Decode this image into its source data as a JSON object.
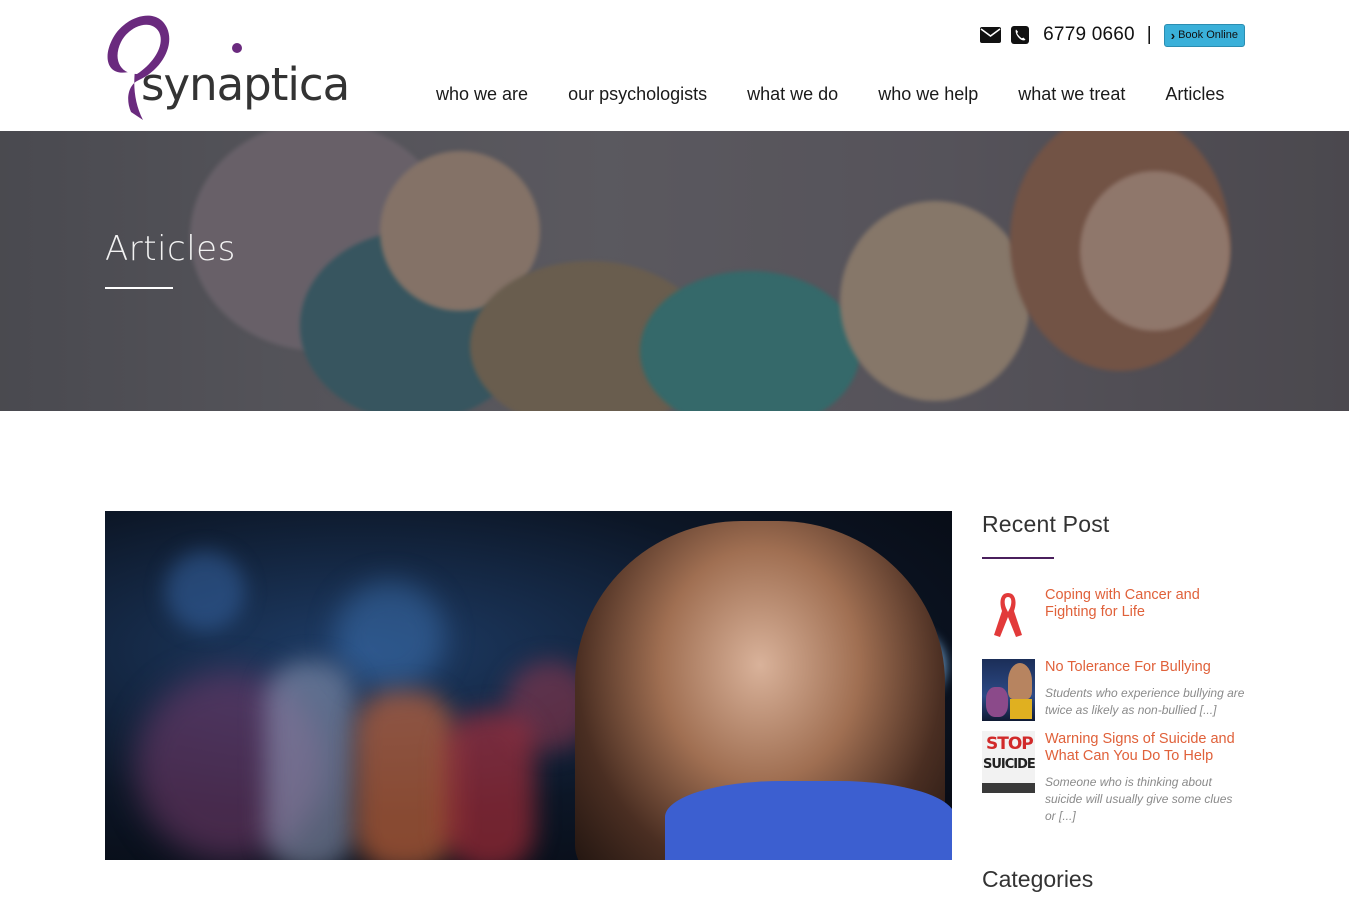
{
  "brand": {
    "name": "synaptica",
    "logo_color": "#6a2a7e"
  },
  "topbar": {
    "email_icon": "envelope-icon",
    "phone_icon": "phone-icon",
    "phone": "6779 0660",
    "separator": "|",
    "book_label": "Book Online",
    "book_color": "#3ab0d9"
  },
  "nav": {
    "items": [
      {
        "label": "who we are"
      },
      {
        "label": "our psychologists"
      },
      {
        "label": "what we do"
      },
      {
        "label": "who we help"
      },
      {
        "label": "what we treat"
      },
      {
        "label": "Articles"
      }
    ]
  },
  "hero": {
    "title": "Articles"
  },
  "sidebar": {
    "recent_heading": "Recent Post",
    "posts": [
      {
        "title": "Coping with Cancer and Fighting for Life",
        "excerpt": "",
        "thumb": "ribbon-icon"
      },
      {
        "title": "No Tolerance For Bullying",
        "excerpt": "Students who experience bullying are twice as likely as non-bullied [...]",
        "thumb": "bullying-thumbnail"
      },
      {
        "title": "Warning Signs of Suicide and What Can You Do To Help",
        "excerpt": "Someone who is thinking about suicide will usually give some clues or [...]",
        "thumb": "stop-suicide-thumbnail"
      }
    ],
    "stop_text": "STOP",
    "suicide_text": "SUICIDE",
    "categories_heading": "Categories",
    "accent_color": "#e0613a"
  }
}
